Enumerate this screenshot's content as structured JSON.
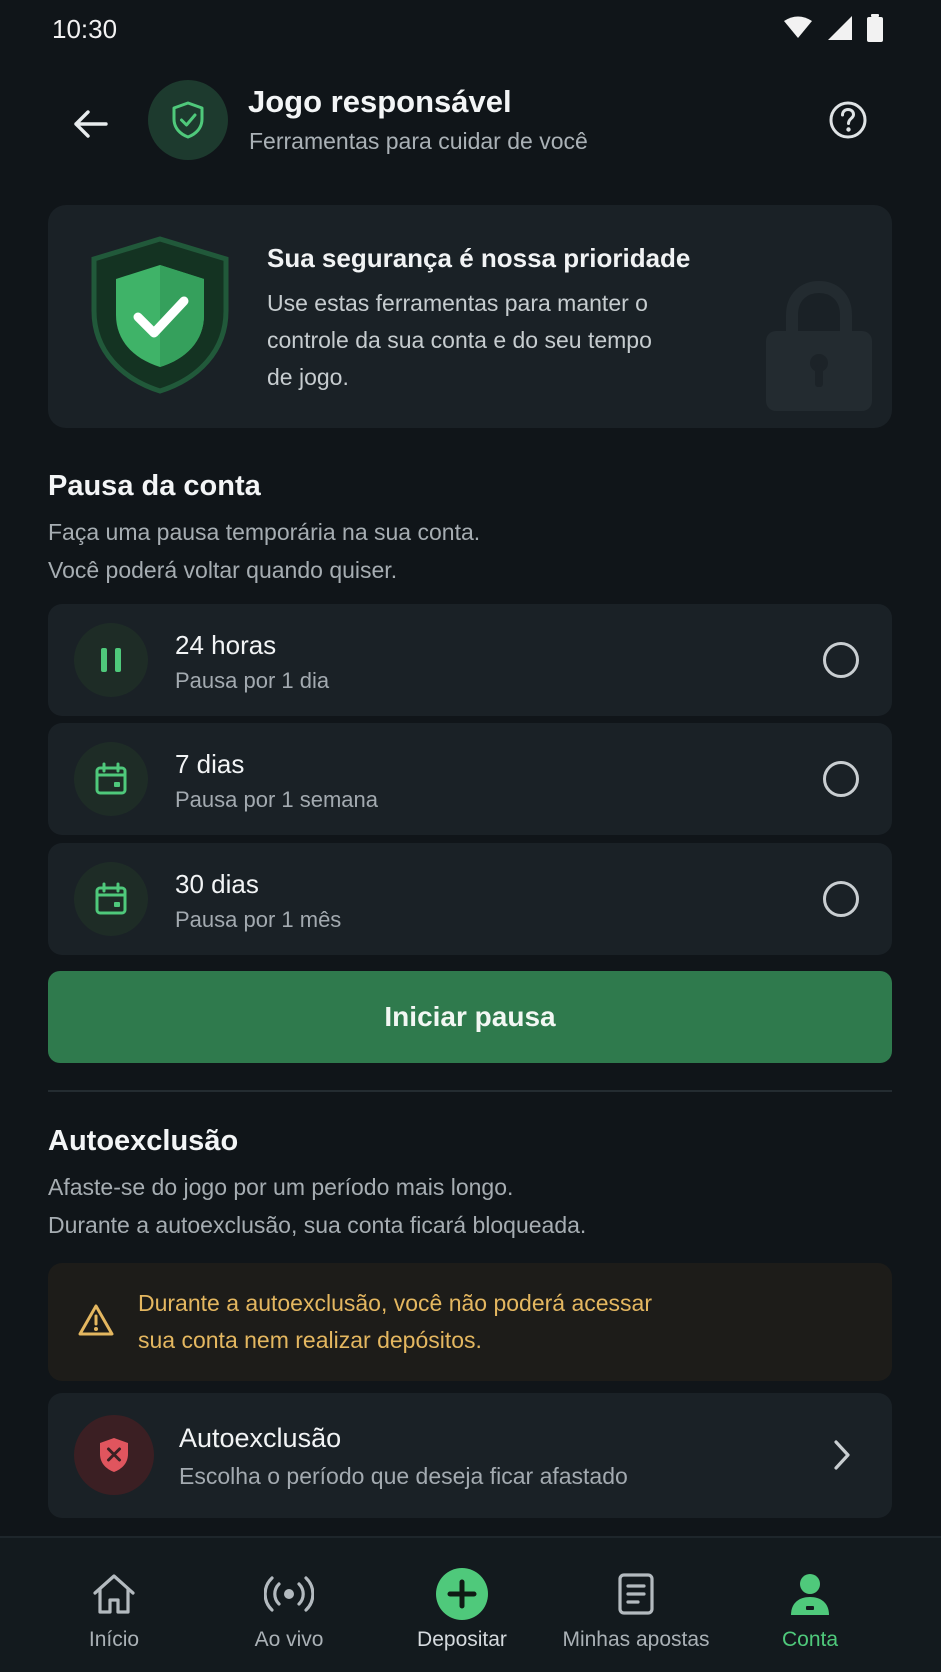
{
  "status_bar": {
    "time": "10:30"
  },
  "header": {
    "title": "Jogo responsável",
    "subtitle": "Ferramentas para cuidar de você"
  },
  "hero": {
    "title": "Sua segurança é nossa prioridade",
    "text": "Use estas ferramentas para manter o controle da sua conta e do seu tempo de jogo."
  },
  "pause": {
    "title": "Pausa da conta",
    "description_line1": "Faça uma pausa temporária na sua conta.",
    "description_line2": "Você poderá voltar quando quiser.",
    "options": [
      {
        "title": "24 horas",
        "subtitle": "Pausa por 1 dia",
        "icon": "pause-icon",
        "selected": false
      },
      {
        "title": "7 dias",
        "subtitle": "Pausa por 1 semana",
        "icon": "calendar-icon",
        "selected": false
      },
      {
        "title": "30 dias",
        "subtitle": "Pausa por 1 mês",
        "icon": "calendar-icon",
        "selected": false
      }
    ],
    "button_label": "Iniciar pausa"
  },
  "self_exclusion": {
    "title": "Autoexclusão",
    "description_line1": "Afaste-se do jogo por um período mais longo.",
    "description_line2": "Durante a autoexclusão, sua conta ficará bloqueada.",
    "warning_line1": "Durante a autoexclusão, você não poderá acessar",
    "warning_line2": "sua conta nem realizar depósitos.",
    "link_title": "Autoexclusão",
    "link_subtitle": "Escolha o período que deseja ficar afastado"
  },
  "bottom_nav": {
    "items": [
      {
        "label": "Início",
        "icon": "home-icon"
      },
      {
        "label": "Ao vivo",
        "icon": "live-icon"
      },
      {
        "label": "Depositar",
        "icon": "plus-circle-icon"
      },
      {
        "label": "Minhas apostas",
        "icon": "document-icon"
      },
      {
        "label": "Conta",
        "icon": "user-icon",
        "active": true
      }
    ]
  },
  "colors": {
    "background": "#101519",
    "card": "#1a2126",
    "accent_green": "#2f7a4d",
    "active_green": "#4fc97b",
    "warning_text": "#e4b760",
    "danger": "#e0555e"
  }
}
